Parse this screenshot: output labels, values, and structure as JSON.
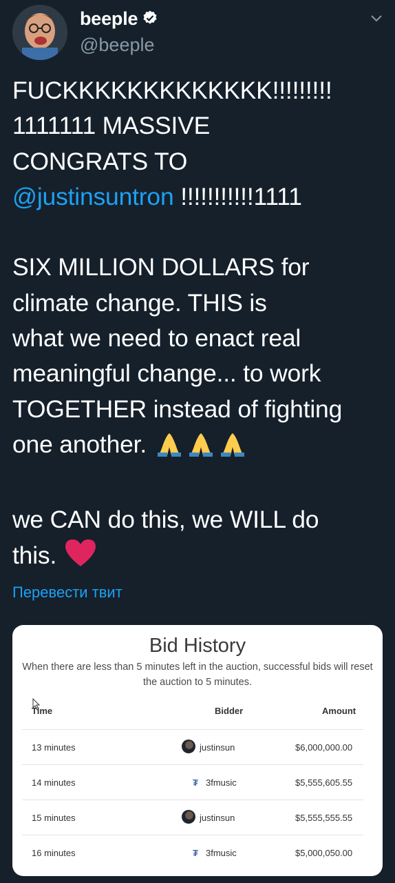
{
  "profile": {
    "name": "beeple",
    "handle": "@beeple"
  },
  "tweet": {
    "line1": "FUCKKKKKKKKKKKKK!!!!!!!!!",
    "line2": "1111111 MASSIVE",
    "line3": "CONGRATS TO",
    "mention": "@justinsuntron",
    "line4_rest": " !!!!!!!!!!!1111",
    "para2_l1": "SIX MILLION DOLLARS for",
    "para2_l2": "climate change.  THIS is",
    "para2_l3": "what we need to enact real",
    "para2_l4": "meaningful change... to work",
    "para2_l5": "TOGETHER instead of fighting",
    "para2_l6": "one another.",
    "para3_l1": "we CAN do this, we WILL do",
    "para3_l2": "this.",
    "translate": "Перевести твит"
  },
  "bid_history": {
    "title": "Bid History",
    "note": "When there are less than 5 minutes left in the auction, successful bids will reset the auction to 5 minutes.",
    "columns": {
      "time": "Time",
      "bidder": "Bidder",
      "amount": "Amount"
    },
    "rows": [
      {
        "time": "13 minutes",
        "bidder": "justinsun",
        "amount": "$6,000,000.00"
      },
      {
        "time": "14 minutes",
        "bidder": "3fmusic",
        "amount": "$5,555,605.55"
      },
      {
        "time": "15 minutes",
        "bidder": "justinsun",
        "amount": "$5,555,555.55"
      },
      {
        "time": "16 minutes",
        "bidder": "3fmusic",
        "amount": "$5,000,050.00"
      }
    ]
  },
  "colors": {
    "background": "#15202b",
    "link": "#1da1f2",
    "muted": "#8899a6",
    "heart": "#e0245e"
  }
}
